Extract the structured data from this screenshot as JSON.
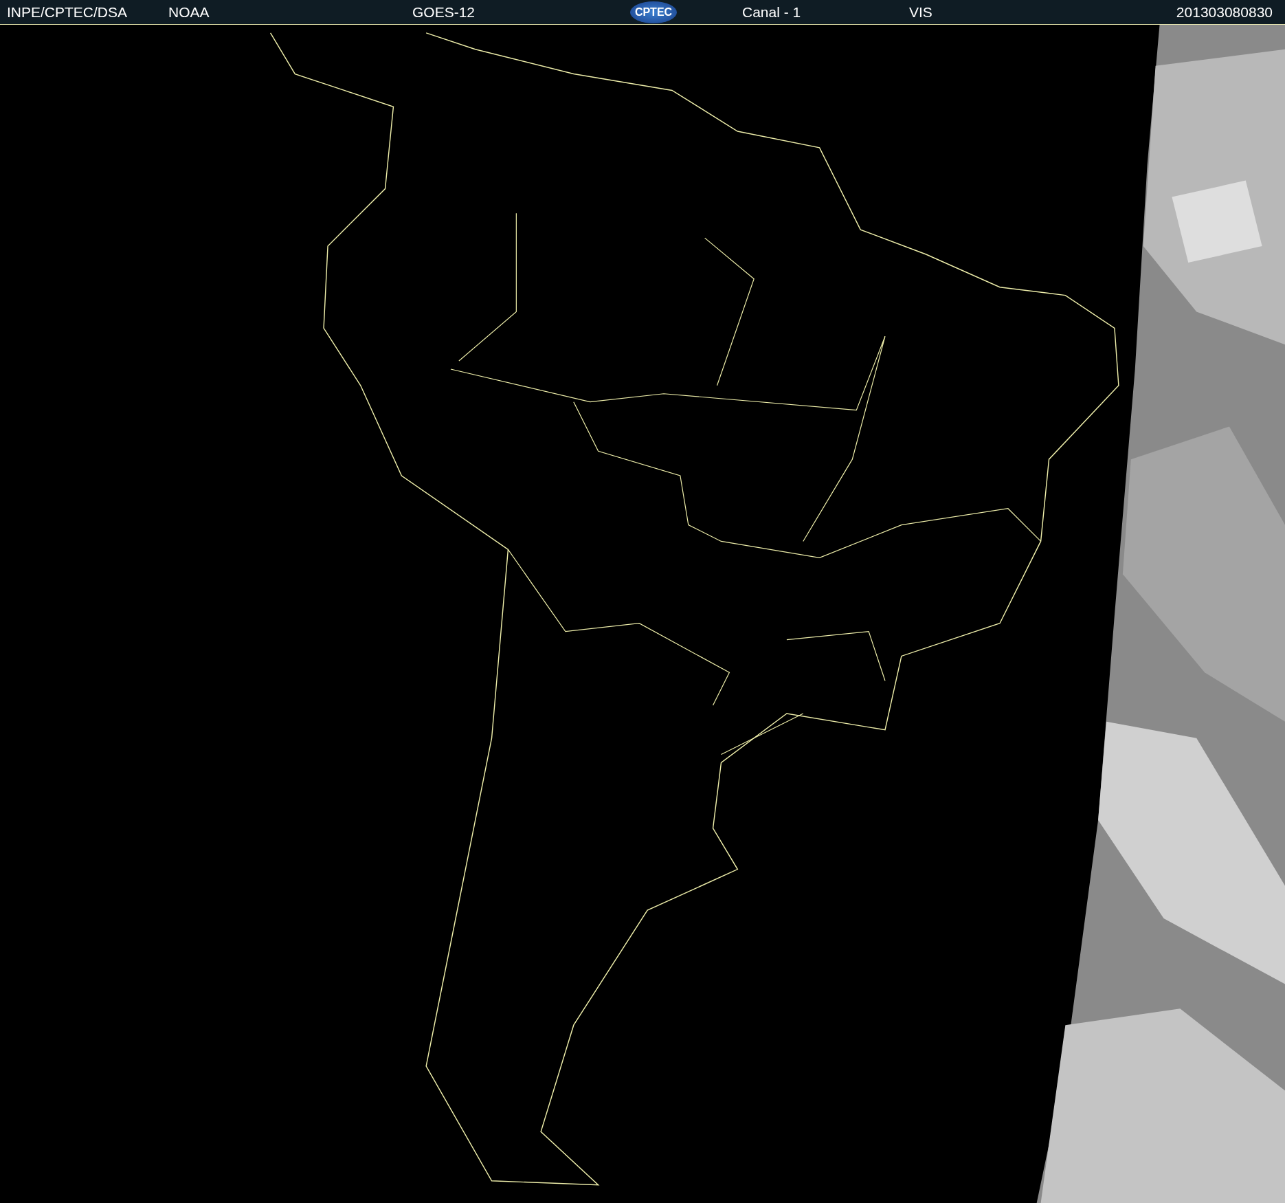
{
  "header": {
    "source": "INPE/CPTEC/DSA",
    "agency": "NOAA",
    "satellite": "GOES-12",
    "logo": "CPTEC",
    "channel": "Canal - 1",
    "band": "VIS",
    "timestamp": "201303080830"
  }
}
